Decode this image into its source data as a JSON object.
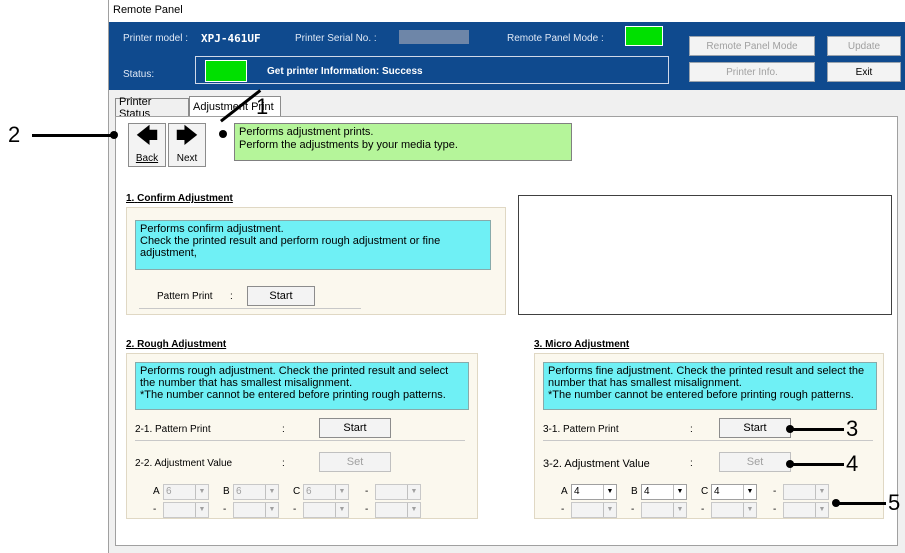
{
  "window": {
    "title": "Remote Panel"
  },
  "header": {
    "printer_model_label": "Printer model :",
    "printer_model_value": "XPJ-461UF",
    "serial_label": "Printer Serial No. :",
    "remote_mode_label": "Remote Panel Mode :",
    "status_label": "Status:",
    "status_message": "Get printer Information: Success",
    "buttons": {
      "remote_panel_mode": "Remote Panel Mode",
      "update": "Update",
      "printer_info": "Printer Info.",
      "exit": "Exit"
    }
  },
  "tabs": [
    "Printer Status",
    "Adjustment Print"
  ],
  "nav": {
    "back": "Back",
    "next": "Next",
    "message_line1": "Performs adjustment prints.",
    "message_line2": "Perform the adjustments by your media type."
  },
  "confirm": {
    "number": "1.",
    "title": "Confirm Adjustment",
    "desc": "Performs confirm adjustment.\nCheck the printed result and perform rough adjustment or fine adjustment,",
    "pattern_label": "Pattern Print",
    "colon": ":",
    "start": "Start"
  },
  "rough": {
    "number": "2.",
    "title": "Rough Adjustment",
    "desc": "Performs rough adjustment. Check the printed result and select the number that has smallest misalignment.\n  *The number cannot be entered before printing rough patterns.",
    "pattern_label": "2-1.  Pattern Print",
    "value_label": "2-2.  Adjustment Value",
    "colon": ":",
    "start": "Start",
    "set": "Set",
    "combos": [
      {
        "label": "A",
        "value": "6"
      },
      {
        "label": "B",
        "value": "6"
      },
      {
        "label": "C",
        "value": "6"
      },
      {
        "label": "-",
        "value": ""
      },
      {
        "label": "-",
        "value": ""
      },
      {
        "label": "-",
        "value": ""
      },
      {
        "label": "-",
        "value": ""
      },
      {
        "label": "-",
        "value": ""
      }
    ]
  },
  "micro": {
    "number": "3.",
    "title": "Micro Adjustment",
    "desc": "Performs fine adjustment. Check the printed result and select the number that has smallest misalignment.\n  *The number cannot be entered before printing rough patterns.",
    "pattern_label": "3-1.  Pattern Print",
    "value_label": "3-2.  Adjustment Value",
    "colon": ":",
    "start": "Start",
    "set": "Set",
    "combos": [
      {
        "label": "A",
        "value": "4"
      },
      {
        "label": "B",
        "value": "4"
      },
      {
        "label": "C",
        "value": "4"
      },
      {
        "label": "-",
        "value": ""
      },
      {
        "label": "-",
        "value": ""
      },
      {
        "label": "-",
        "value": ""
      },
      {
        "label": "-",
        "value": ""
      },
      {
        "label": "-",
        "value": ""
      }
    ]
  },
  "annotations": [
    "1",
    "2",
    "3",
    "4",
    "5"
  ]
}
